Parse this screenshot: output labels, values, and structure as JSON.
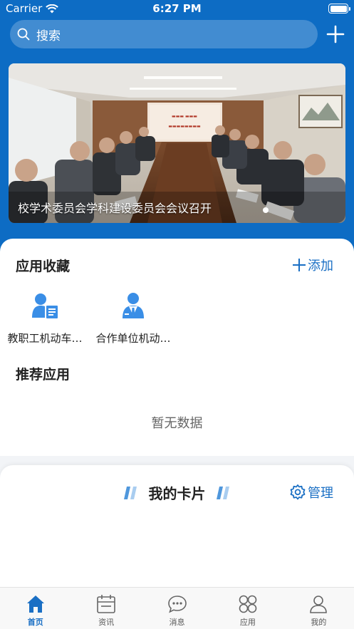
{
  "status_bar": {
    "carrier": "Carrier",
    "time": "6:27 PM"
  },
  "search": {
    "placeholder": "搜索"
  },
  "banner": {
    "caption": "校学术委员会学科建设委员会会议召开",
    "page_count": 1,
    "current_page": 1
  },
  "favorites": {
    "title": "应用收藏",
    "add_label": "添加",
    "apps": [
      {
        "label": "教职工机动车…",
        "icon": "staff-card-icon"
      },
      {
        "label": "合作单位机动…",
        "icon": "partner-person-icon"
      }
    ]
  },
  "recommended": {
    "title": "推荐应用",
    "empty_text": "暂无数据"
  },
  "my_card": {
    "title": "我的卡片",
    "manage_label": "管理"
  },
  "tab_bar": {
    "tabs": [
      {
        "label": "首页",
        "icon": "home-icon",
        "active": true
      },
      {
        "label": "资讯",
        "icon": "news-icon",
        "active": false
      },
      {
        "label": "消息",
        "icon": "message-icon",
        "active": false
      },
      {
        "label": "应用",
        "icon": "apps-icon",
        "active": false
      },
      {
        "label": "我的",
        "icon": "profile-icon",
        "active": false
      }
    ]
  },
  "colors": {
    "brand_blue": "#0d6cc4",
    "accent_blue": "#1a6fc4",
    "icon_blue": "#3a8ee6"
  }
}
